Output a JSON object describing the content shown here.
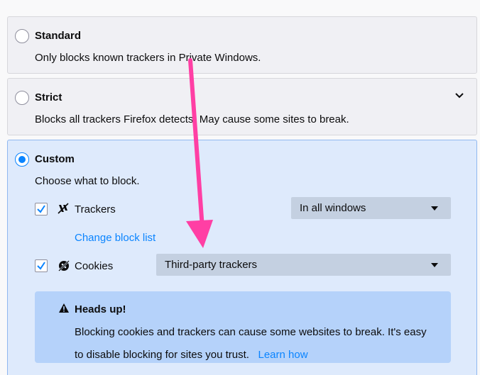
{
  "options": {
    "standard": {
      "title": "Standard",
      "description": "Only blocks known trackers in Private Windows.",
      "selected": false
    },
    "strict": {
      "title": "Strict",
      "description": "Blocks all trackers Firefox detects. May cause some sites to break.",
      "selected": false
    },
    "custom": {
      "title": "Custom",
      "description": "Choose what to block.",
      "selected": true
    }
  },
  "custom": {
    "trackers": {
      "label": "Trackers",
      "checked": true,
      "icon": "tracker-icon",
      "select_value": "In all windows",
      "change_link": "Change block list"
    },
    "cookies": {
      "label": "Cookies",
      "checked": true,
      "icon": "cookie-icon",
      "select_value": "Third-party trackers"
    },
    "warning": {
      "icon": "warning-icon",
      "title": "Heads up!",
      "body": "Blocking cookies and trackers can cause some websites to break. It's easy to disable blocking for sites you trust.",
      "link": "Learn how"
    }
  },
  "colors": {
    "accent": "#0a84ff",
    "annotation_arrow": "#ff3fa4",
    "custom_bg": "#deeafc",
    "warning_bg": "#b5d2fa"
  }
}
